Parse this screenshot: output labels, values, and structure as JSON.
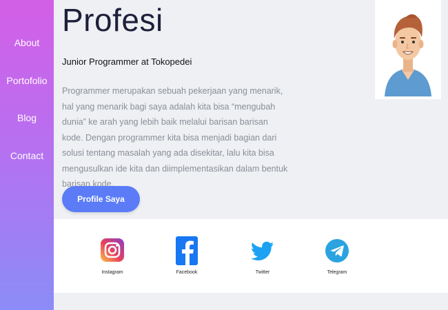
{
  "sidebar": {
    "items": [
      {
        "label": "About"
      },
      {
        "label": "Portofolio"
      },
      {
        "label": "Blog"
      },
      {
        "label": "Contact"
      }
    ]
  },
  "main": {
    "title": "Profesi",
    "subtitle": "Junior Programmer at Tokopedei",
    "description": "Programmer merupakan sebuah pekerjaan yang menarik, hal yang menarik bagi saya adalah kita bisa “mengubah dunia” ke arah yang lebih baik melalui barisan barisan kode. Dengan programmer kita bisa menjadi bagian dari solusi tentang masalah yang ada disekitar, lalu kita bisa mengusulkan ide kita dan diimplementasikan dalam bentuk barisan kode.",
    "button_label": "Profile Saya"
  },
  "avatar": {
    "icon": "user-avatar-illustration"
  },
  "social": [
    {
      "label": "Instagram",
      "icon": "instagram-icon"
    },
    {
      "label": "Facebook",
      "icon": "facebook-icon"
    },
    {
      "label": "Twitter",
      "icon": "twitter-icon"
    },
    {
      "label": "Telegram",
      "icon": "telegram-icon"
    }
  ],
  "colors": {
    "sidebar_top": "#d35fe6",
    "sidebar_bottom": "#8b8cf7",
    "button": "#5b7cf6",
    "background": "#eef0f4"
  }
}
